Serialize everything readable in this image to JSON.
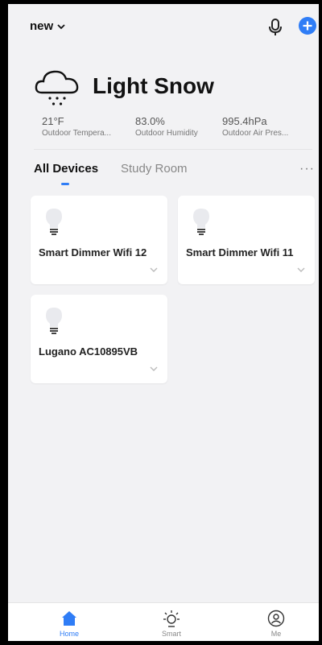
{
  "header": {
    "home_name": "new"
  },
  "weather": {
    "condition": "Light Snow",
    "metrics": [
      {
        "value": "21°F",
        "label": "Outdoor Tempera..."
      },
      {
        "value": "83.0%",
        "label": "Outdoor Humidity"
      },
      {
        "value": "995.4hPa",
        "label": "Outdoor Air Pres..."
      }
    ]
  },
  "tabs": {
    "items": [
      "All Devices",
      "Study Room"
    ],
    "active": "All Devices",
    "more": "···"
  },
  "devices": [
    {
      "name": "Smart Dimmer Wifi 12",
      "icon": "bulb-icon"
    },
    {
      "name": "Smart Dimmer Wifi 11",
      "icon": "bulb-icon"
    },
    {
      "name": "Lugano AC10895VB",
      "icon": "bulb-icon"
    }
  ],
  "bottom_nav": [
    {
      "label": "Home",
      "icon": "home-icon",
      "active": true
    },
    {
      "label": "Smart",
      "icon": "sun-icon",
      "active": false
    },
    {
      "label": "Me",
      "icon": "profile-icon",
      "active": false
    }
  ],
  "colors": {
    "accent": "#2f7df6",
    "background": "#f2f2f4"
  }
}
